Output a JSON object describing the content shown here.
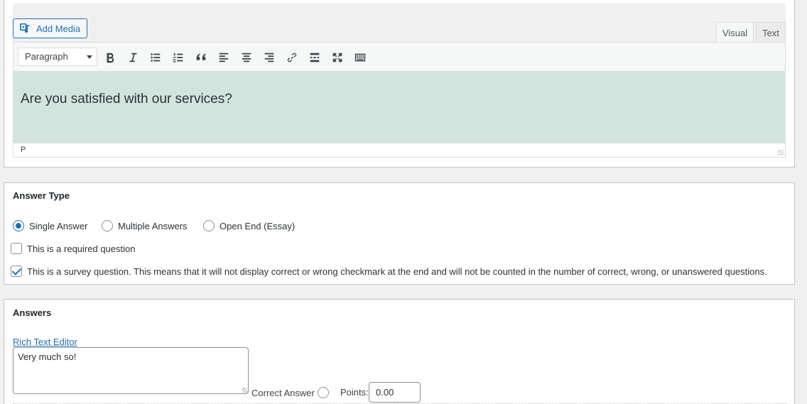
{
  "editor": {
    "add_media_label": "Add Media",
    "tabs": [
      {
        "label": "Visual",
        "active": true
      },
      {
        "label": "Text",
        "active": false
      }
    ],
    "format_select": "Paragraph",
    "toolbar_icons": [
      "bold-icon",
      "italic-icon",
      "bulleted-list-icon",
      "numbered-list-icon",
      "blockquote-icon",
      "align-left-icon",
      "align-center-icon",
      "align-right-icon",
      "link-icon",
      "read-more-icon",
      "fullscreen-icon",
      "toolbar-toggle-icon"
    ],
    "content": "Are you satisfied with our services?",
    "path": "P",
    "content_bg": "#d2e4de"
  },
  "answer_type": {
    "heading": "Answer Type",
    "options": [
      {
        "label": "Single Answer",
        "checked": true
      },
      {
        "label": "Multiple Answers",
        "checked": false
      },
      {
        "label": "Open End (Essay)",
        "checked": false
      }
    ],
    "required_label": "This is a required question",
    "required_checked": false,
    "survey_label": "This is a survey question. This means that it will not display correct or wrong checkmark at the end and will not be counted in the number of correct, wrong, or unanswered questions.",
    "survey_checked": true
  },
  "answers": {
    "heading": "Answers",
    "rte_link": "Rich Text Editor",
    "answer_text": "Very much so!",
    "correct_label": "Correct Answer",
    "points_label": "Points:",
    "points_value": "0.00"
  },
  "colors": {
    "accent": "#2271b1",
    "border": "#c3c4c7",
    "background": "#f0f0f1"
  }
}
